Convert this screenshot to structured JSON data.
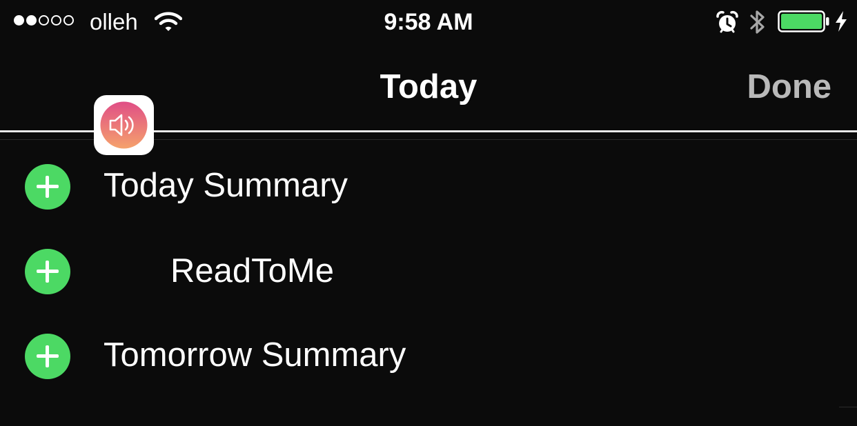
{
  "status_bar": {
    "signal_filled": 2,
    "signal_total": 5,
    "carrier": "olleh",
    "time": "9:58 AM",
    "icons": [
      "wifi-icon",
      "alarm-icon",
      "bluetooth-icon",
      "battery-icon",
      "charging-icon"
    ],
    "battery_level": 1.0
  },
  "nav": {
    "title": "Today",
    "done_label": "Done"
  },
  "widgets": [
    {
      "label": "Today Summary",
      "icon": null
    },
    {
      "label": "ReadToMe",
      "icon": "readtome-speaker-icon"
    },
    {
      "label": "Tomorrow Summary",
      "icon": null
    }
  ],
  "colors": {
    "background": "#0b0b0b",
    "add_button": "#4cd964",
    "done_text": "#b9b9b9",
    "battery_fill": "#4cd964",
    "icon_gradient_top": "#e04e86",
    "icon_gradient_bottom": "#f5a26c"
  }
}
